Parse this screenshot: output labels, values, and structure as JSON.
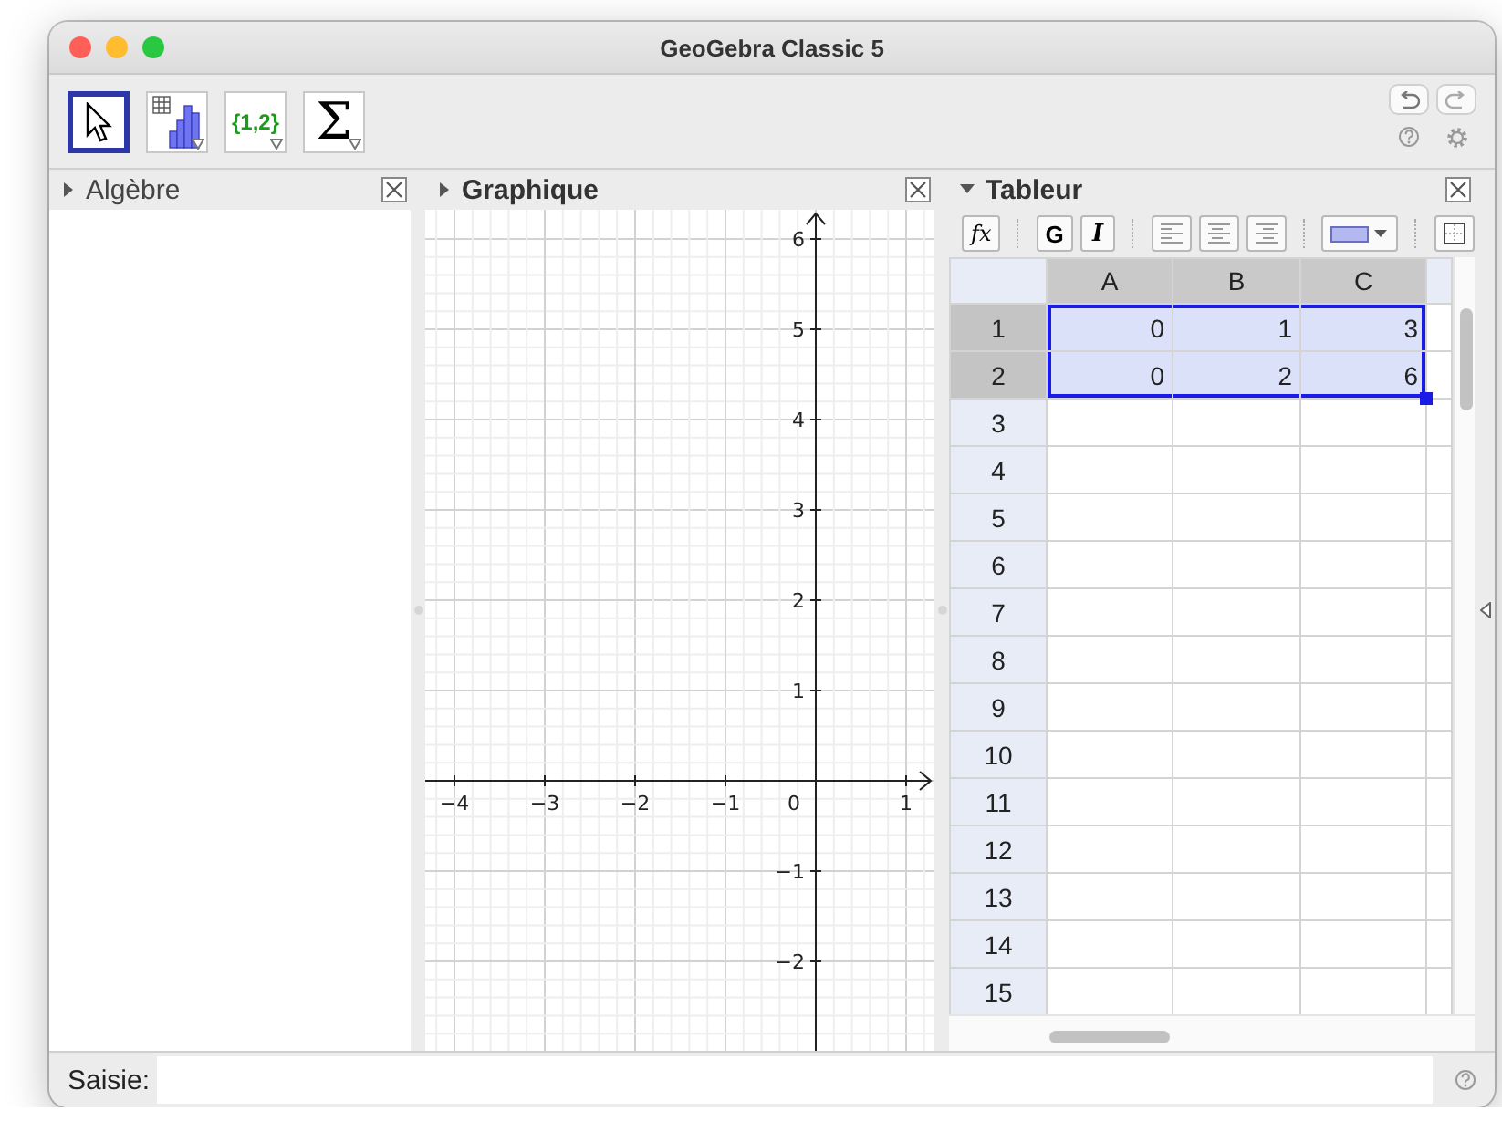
{
  "window": {
    "title": "GeoGebra Classic 5"
  },
  "toolbar": {
    "tools": [
      {
        "kind": "pointer",
        "selected": true
      },
      {
        "kind": "bar-chart",
        "selected": false
      },
      {
        "kind": "text",
        "label": "{1,2}",
        "selected": false
      },
      {
        "kind": "text",
        "label": "Σ",
        "selected": false
      }
    ]
  },
  "panels": [
    {
      "kind": "algebra",
      "title": "Algèbre",
      "active": false,
      "style_bar_open": false
    },
    {
      "kind": "graphics",
      "title": "Graphique",
      "active": true,
      "style_bar_open": false,
      "x_labels": [
        "−4",
        "−3",
        "−2",
        "−1",
        "1"
      ],
      "origin_label": "0",
      "y_labels": [
        "6",
        "5",
        "4",
        "3",
        "2",
        "1",
        "−1",
        "−2"
      ]
    },
    {
      "kind": "spreadsheet",
      "title": "Tableur",
      "active": true,
      "style_bar_open": true,
      "style_bar": {
        "formula": "fx",
        "bold": {
          "label": "G",
          "selected": false
        },
        "italic": {
          "label": "I",
          "selected": false
        }
      },
      "columns": [
        {
          "label": "A",
          "selected": true
        },
        {
          "label": "B",
          "selected": true
        },
        {
          "label": "C",
          "selected": true
        }
      ],
      "rows": [
        {
          "label": "1",
          "selected": true,
          "cells": [
            {
              "value": "0",
              "selected": true
            },
            {
              "value": "1",
              "selected": true
            },
            {
              "value": "3",
              "selected": true
            }
          ]
        },
        {
          "label": "2",
          "selected": true,
          "cells": [
            {
              "value": "0",
              "selected": true
            },
            {
              "value": "2",
              "selected": true
            },
            {
              "value": "6",
              "selected": true
            }
          ]
        },
        {
          "label": "3",
          "selected": false
        },
        {
          "label": "4",
          "selected": false
        },
        {
          "label": "5",
          "selected": false
        },
        {
          "label": "6",
          "selected": false
        },
        {
          "label": "7",
          "selected": false
        },
        {
          "label": "8",
          "selected": false
        },
        {
          "label": "9",
          "selected": false
        },
        {
          "label": "10",
          "selected": false
        },
        {
          "label": "11",
          "selected": false
        },
        {
          "label": "12",
          "selected": false
        },
        {
          "label": "13",
          "selected": false
        },
        {
          "label": "14",
          "selected": false
        },
        {
          "label": "15",
          "selected": false
        }
      ]
    }
  ],
  "input_bar": {
    "label": "Saisie:"
  }
}
